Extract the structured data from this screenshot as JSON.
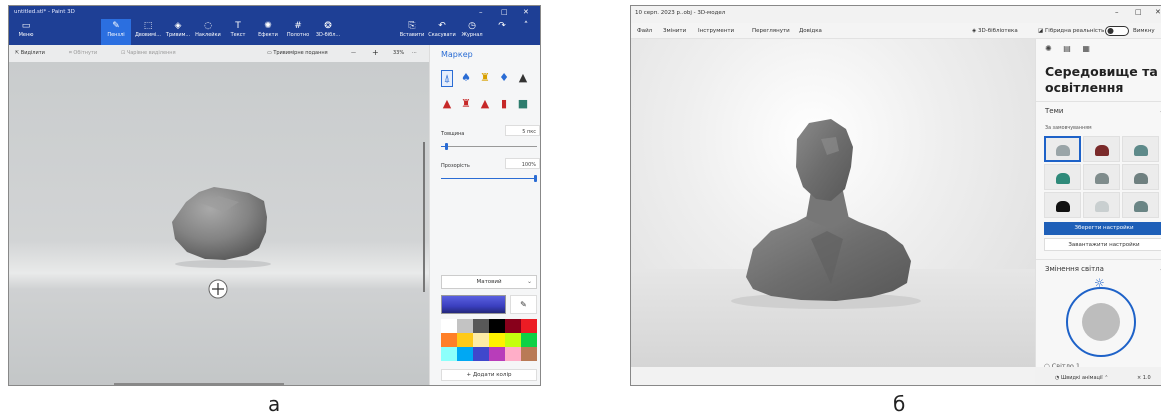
{
  "captions": {
    "a": "а",
    "b": "б"
  },
  "paint3d": {
    "title": "untitled.stl* - Paint 3D",
    "window_controls": {
      "minimize": "–",
      "maximize": "□",
      "close": "✕"
    },
    "ribbon": {
      "menu": "Меню",
      "tools": [
        "Пензлі",
        "Двовимі...",
        "Тривим...",
        "Наклейки",
        "Текст",
        "Ефекти",
        "Полотно",
        "3D-бібл..."
      ],
      "right": [
        "Вставити",
        "Скасувати",
        "Журнал"
      ]
    },
    "toolbar": {
      "select": "Виділити",
      "crop": "Обітнути",
      "magic_select": "Чарівне виділення",
      "view_3d": "Тривимірне подання",
      "zoom_out": "—",
      "zoom_in": "+",
      "zoom": "33%",
      "more": "···"
    },
    "panel": {
      "title": "Маркер",
      "thickness_label": "Товщина",
      "thickness_value": "5 пкс",
      "thickness_level": 0.04,
      "opacity_label": "Прозорість",
      "opacity_value": "100%",
      "opacity_level": 1.0,
      "finish": "Матовий",
      "add_color": "Додати колір",
      "current_color": "#3a3fbf",
      "palette": [
        "#ffffff",
        "#c3c3c3",
        "#585858",
        "#000000",
        "#88001b",
        "#ec1c24",
        "#ff7f27",
        "#ffca18",
        "#fdeca6",
        "#fff200",
        "#c4ff0e",
        "#0ed145",
        "#8cfffb",
        "#00a8f3",
        "#3f48cc",
        "#b83dba",
        "#ffaec8",
        "#b97a56"
      ]
    }
  },
  "viewer": {
    "title": "10 серп. 2023 р..obj - 3D-модел",
    "window_controls": {
      "minimize": "–",
      "maximize": "□",
      "close": "✕"
    },
    "menu": [
      "Файл",
      "Змінити",
      "Інструменти",
      "Переглянути",
      "Довідка"
    ],
    "right_menu": {
      "library": "3D-бібліотека",
      "mixed_reality": "Гібридна реальність",
      "output": "Вимкну"
    },
    "panel": {
      "heading": "Середовище та освітлення",
      "themes_label": "Теми",
      "default_label": "За замовчуванням",
      "save_button": "Зберегти настройки",
      "load_button": "Завантажити настройки",
      "lighting_label": "Змінення світла",
      "light1_label": "Світло 1"
    },
    "status": {
      "animations": "Швидкі анімації",
      "scale": "× 1.0"
    }
  }
}
